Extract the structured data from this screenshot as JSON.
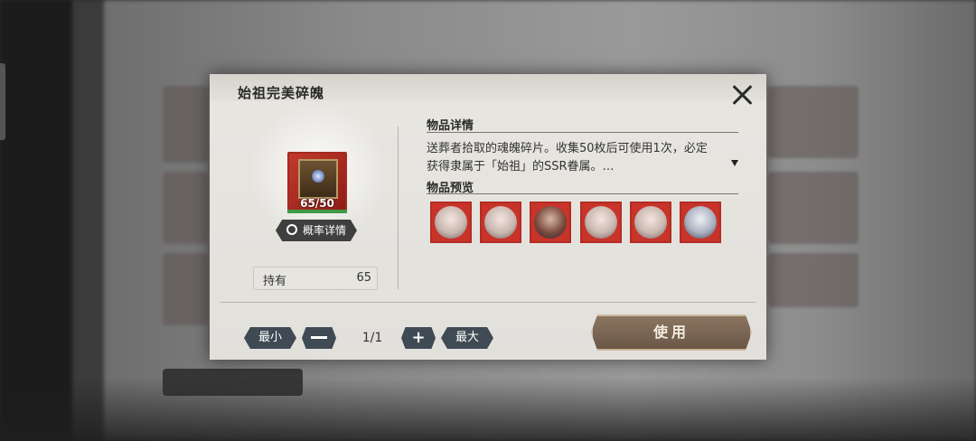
{
  "dialog": {
    "title": "始祖完美碎魄",
    "item": {
      "count": "65/50"
    },
    "probability_button": "概率详情",
    "hold": {
      "label": "持有",
      "value": "65"
    },
    "details": {
      "title": "物品详情",
      "description": "送葬者拾取的魂魄碎片。收集50枚后可使用1次，必定获得隶属于「始祖」的SSR眷属。…"
    },
    "preview": {
      "title": "物品预览",
      "items_count": 6
    },
    "quantity": {
      "min_label": "最小",
      "value": "1/1",
      "max_label": "最大"
    },
    "use_button": "使用"
  },
  "colors": {
    "accent_red": "#c8332a",
    "use_button": "#7a6553",
    "dark_button": "#3f4a54"
  }
}
